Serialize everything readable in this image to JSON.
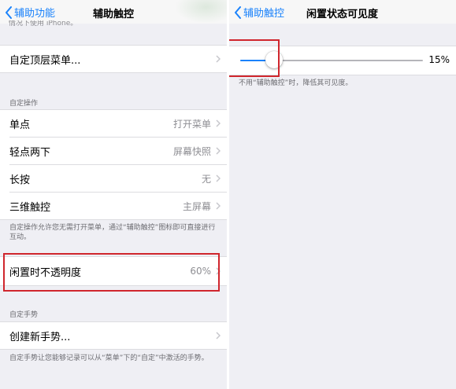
{
  "colors": {
    "accent": "#1a82fb",
    "highlight_box": "#d0262d",
    "group_bg": "#efeff4"
  },
  "left": {
    "nav": {
      "back_label": "辅助功能",
      "title": "辅助触控"
    },
    "cut_text": "情况下使用 iPhone。",
    "custom_menu": {
      "label": "自定顶层菜单..."
    },
    "custom_actions": {
      "header": "自定操作",
      "rows": [
        {
          "label": "单点",
          "value": "打开菜单"
        },
        {
          "label": "轻点两下",
          "value": "屏幕快照"
        },
        {
          "label": "长按",
          "value": "无"
        },
        {
          "label": "三维触控",
          "value": "主屏幕"
        }
      ],
      "footer": "自定操作允许您无需打开菜单，通过“辅助触控”图标即可直接进行互动。"
    },
    "idle_opacity": {
      "label": "闲置时不透明度",
      "value": "60%"
    },
    "custom_gestures": {
      "header": "自定手势",
      "create_label": "创建新手势...",
      "footer": "自定手势让您能够记录可以从“菜单”下的“自定”中激活的手势。"
    }
  },
  "right": {
    "nav": {
      "back_label": "辅助触控",
      "title": "闲置状态可见度"
    },
    "slider": {
      "value_fraction": 0.15,
      "value_label": "15%"
    },
    "footer": "不用“辅助触控”时，降低其可见度。"
  }
}
